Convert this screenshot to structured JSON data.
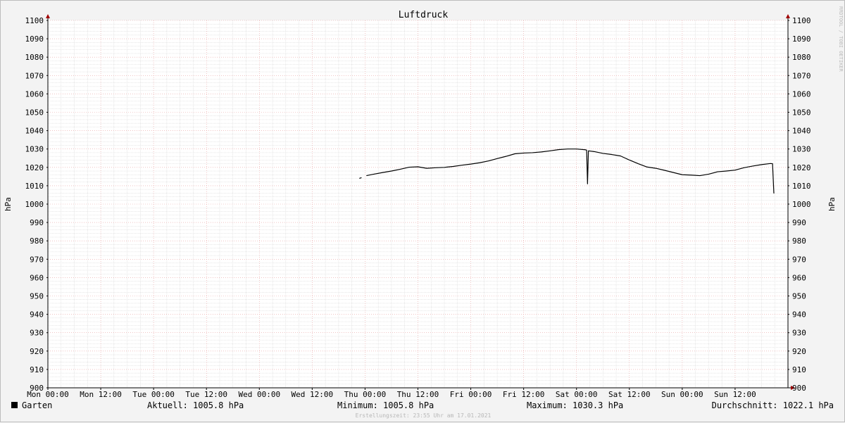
{
  "chart_data": {
    "type": "line",
    "title": "Luftdruck",
    "ylabel_left": "hPa",
    "ylabel_right": "hPa",
    "ylim": [
      900,
      1100
    ],
    "yticks": [
      900,
      910,
      920,
      930,
      940,
      950,
      960,
      970,
      980,
      990,
      1000,
      1010,
      1020,
      1030,
      1040,
      1050,
      1060,
      1070,
      1080,
      1090,
      1100
    ],
    "xlim_hours": [
      0,
      168
    ],
    "xticks": [
      {
        "h": 0,
        "label": "Mon 00:00"
      },
      {
        "h": 12,
        "label": "Mon 12:00"
      },
      {
        "h": 24,
        "label": "Tue 00:00"
      },
      {
        "h": 36,
        "label": "Tue 12:00"
      },
      {
        "h": 48,
        "label": "Wed 00:00"
      },
      {
        "h": 60,
        "label": "Wed 12:00"
      },
      {
        "h": 72,
        "label": "Thu 00:00"
      },
      {
        "h": 84,
        "label": "Thu 12:00"
      },
      {
        "h": 96,
        "label": "Fri 00:00"
      },
      {
        "h": 108,
        "label": "Fri 12:00"
      },
      {
        "h": 120,
        "label": "Sat 00:00"
      },
      {
        "h": 132,
        "label": "Sat 12:00"
      },
      {
        "h": 144,
        "label": "Sun 00:00"
      },
      {
        "h": 156,
        "label": "Sun 12:00"
      }
    ],
    "grid": true,
    "series": [
      {
        "name": "Garten",
        "color": "#000000",
        "segments": [
          [
            [
              70.7,
              1014.0
            ],
            [
              71.2,
              1014.4
            ]
          ],
          [
            [
              72.3,
              1015.5
            ],
            [
              74,
              1016.3
            ],
            [
              76,
              1017.2
            ],
            [
              78,
              1018.0
            ],
            [
              80,
              1019.0
            ],
            [
              82,
              1020.1
            ],
            [
              84,
              1020.3
            ],
            [
              86,
              1019.5
            ],
            [
              88,
              1019.8
            ],
            [
              90,
              1020.0
            ],
            [
              92,
              1020.5
            ],
            [
              94,
              1021.2
            ],
            [
              96,
              1021.8
            ],
            [
              98,
              1022.5
            ],
            [
              100,
              1023.5
            ],
            [
              102,
              1024.8
            ],
            [
              104,
              1026.0
            ],
            [
              106,
              1027.4
            ],
            [
              108,
              1027.8
            ],
            [
              110,
              1028.0
            ],
            [
              112,
              1028.4
            ],
            [
              114,
              1029.0
            ],
            [
              116,
              1029.7
            ],
            [
              118,
              1030.0
            ],
            [
              120,
              1030.0
            ],
            [
              122,
              1029.6
            ],
            [
              122.3,
              1029.4
            ],
            [
              122.5,
              1011.0
            ],
            [
              122.7,
              1029.0
            ],
            [
              124,
              1028.6
            ],
            [
              126,
              1027.6
            ],
            [
              128,
              1027.0
            ],
            [
              130,
              1026.2
            ],
            [
              132,
              1024.0
            ],
            [
              134,
              1022.0
            ],
            [
              136,
              1020.2
            ],
            [
              138,
              1019.5
            ],
            [
              140,
              1018.4
            ],
            [
              142,
              1017.2
            ],
            [
              144,
              1016.0
            ],
            [
              146,
              1015.8
            ],
            [
              148,
              1015.5
            ],
            [
              150,
              1016.3
            ],
            [
              152,
              1017.6
            ],
            [
              154,
              1018.0
            ],
            [
              156,
              1018.5
            ],
            [
              158,
              1019.8
            ],
            [
              160,
              1020.7
            ],
            [
              162,
              1021.5
            ],
            [
              164,
              1022.1
            ],
            [
              164.5,
              1022.0
            ],
            [
              164.8,
              1005.8
            ]
          ]
        ]
      }
    ],
    "legend": {
      "name": "Garten",
      "color": "#000000",
      "aktuell": "Aktuell: 1005.8 hPa",
      "minimum": "Minimum: 1005.8 hPa",
      "maximum": "Maximum: 1030.3 hPa",
      "durchschnitt": "Durchschnitt: 1022.1 hPa"
    },
    "watermark": "RRDTOOL / TOBI OETIKER",
    "footer": "Erstellungszeit: 23:55 Uhr am 17.01.2021",
    "colors": {
      "background": "#f3f3f3",
      "plot_background": "#ffffff",
      "major_grid": "#e8a0a0",
      "minor_grid": "#cfcfcf",
      "axis": "#000000",
      "arrow": "#a00000"
    }
  }
}
